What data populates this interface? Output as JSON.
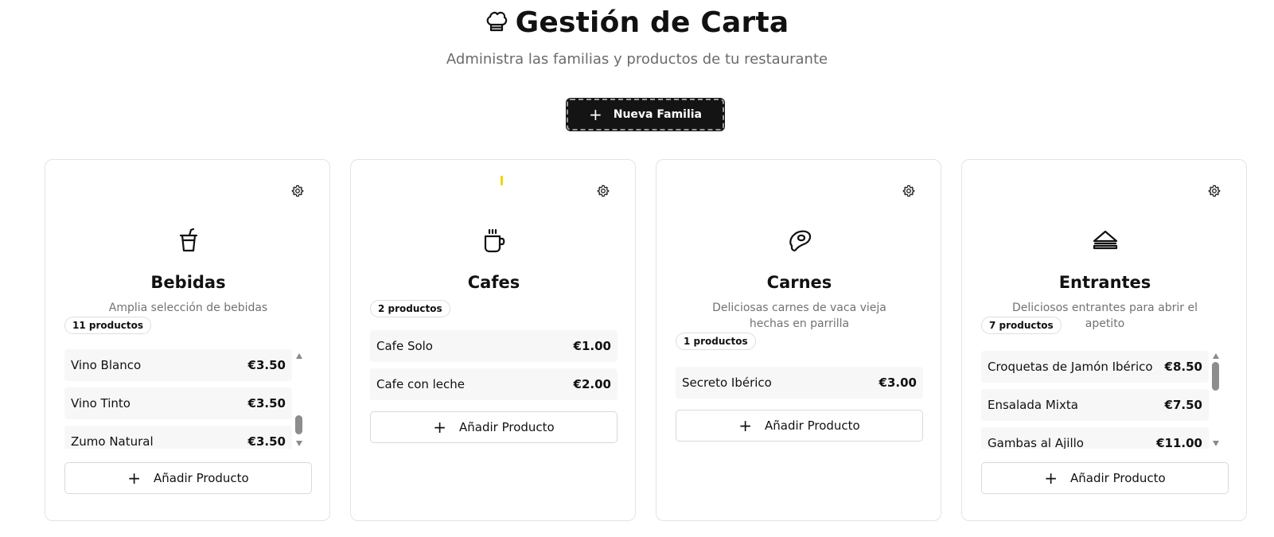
{
  "header": {
    "title": "Gestión de Carta",
    "title_icon": "chef-hat-icon",
    "subtitle": "Administra las familias y productos de tu restaurante"
  },
  "new_family_button": {
    "plus": "+",
    "label": "Nueva Familia"
  },
  "add_product_label": "Añadir Producto",
  "add_plus": "+",
  "families": [
    {
      "name": "Bebidas",
      "icon": "cup-straw-icon",
      "description": "Amplia selección de bebidas",
      "count": "11 productos",
      "products": [
        {
          "name": "Vino Blanco",
          "price": "€3.50"
        },
        {
          "name": "Vino Tinto",
          "price": "€3.50"
        },
        {
          "name": "Zumo Natural",
          "price": "€3.50"
        }
      ]
    },
    {
      "name": "Cafes",
      "icon": "coffee-cup-icon",
      "description": "",
      "count": "2 productos",
      "products": [
        {
          "name": "Cafe Solo",
          "price": "€1.00"
        },
        {
          "name": "Cafe con leche",
          "price": "€2.00"
        }
      ]
    },
    {
      "name": "Carnes",
      "icon": "steak-icon",
      "description": "Deliciosas carnes de vaca vieja hechas en parrilla",
      "count": "1 productos",
      "products": [
        {
          "name": "Secreto Ibérico",
          "price": "€3.00"
        }
      ]
    },
    {
      "name": "Entrantes",
      "icon": "sandwich-icon",
      "description": "Deliciosos entrantes para abrir el apetito",
      "count": "7 productos",
      "products": [
        {
          "name": "Croquetas de Jamón Ibérico",
          "price": "€8.50"
        },
        {
          "name": "Ensalada Mixta",
          "price": "€7.50"
        },
        {
          "name": "Gambas al Ajillo",
          "price": "€11.00"
        }
      ]
    }
  ],
  "colors": {
    "primary_button": "#141414",
    "accent_marker": "#f2d600"
  }
}
